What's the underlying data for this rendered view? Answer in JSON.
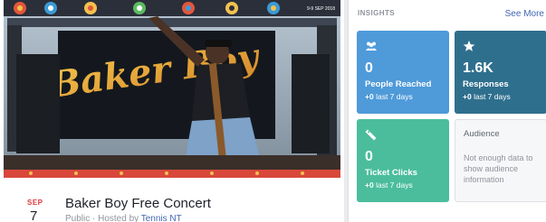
{
  "event": {
    "month": "SEP",
    "day": "7",
    "title": "Baker Boy Free Concert",
    "subtitle_prefix": "Public · Hosted by ",
    "host": "Tennis NT",
    "cover_logo_text": "Baker Boy",
    "cover_corner_text": "9-9 SEP 2018"
  },
  "insights": {
    "header": "INSIGHTS",
    "see_more": "See More",
    "tiles": [
      {
        "number": "0",
        "label": "People Reached",
        "delta": "+0",
        "period": "last 7 days",
        "icon": "people-icon",
        "color": "#4f9ad9"
      },
      {
        "number": "1.6K",
        "label": "Responses",
        "delta": "+0",
        "period": "last 7 days",
        "icon": "star-icon",
        "color": "#2f6f8e"
      },
      {
        "number": "0",
        "label": "Ticket Clicks",
        "delta": "+0",
        "period": "last 7 days",
        "icon": "ticket-icon",
        "color": "#4bbd9c"
      }
    ],
    "audience": {
      "title": "Audience",
      "note": "Not enough data to show audience information"
    }
  }
}
